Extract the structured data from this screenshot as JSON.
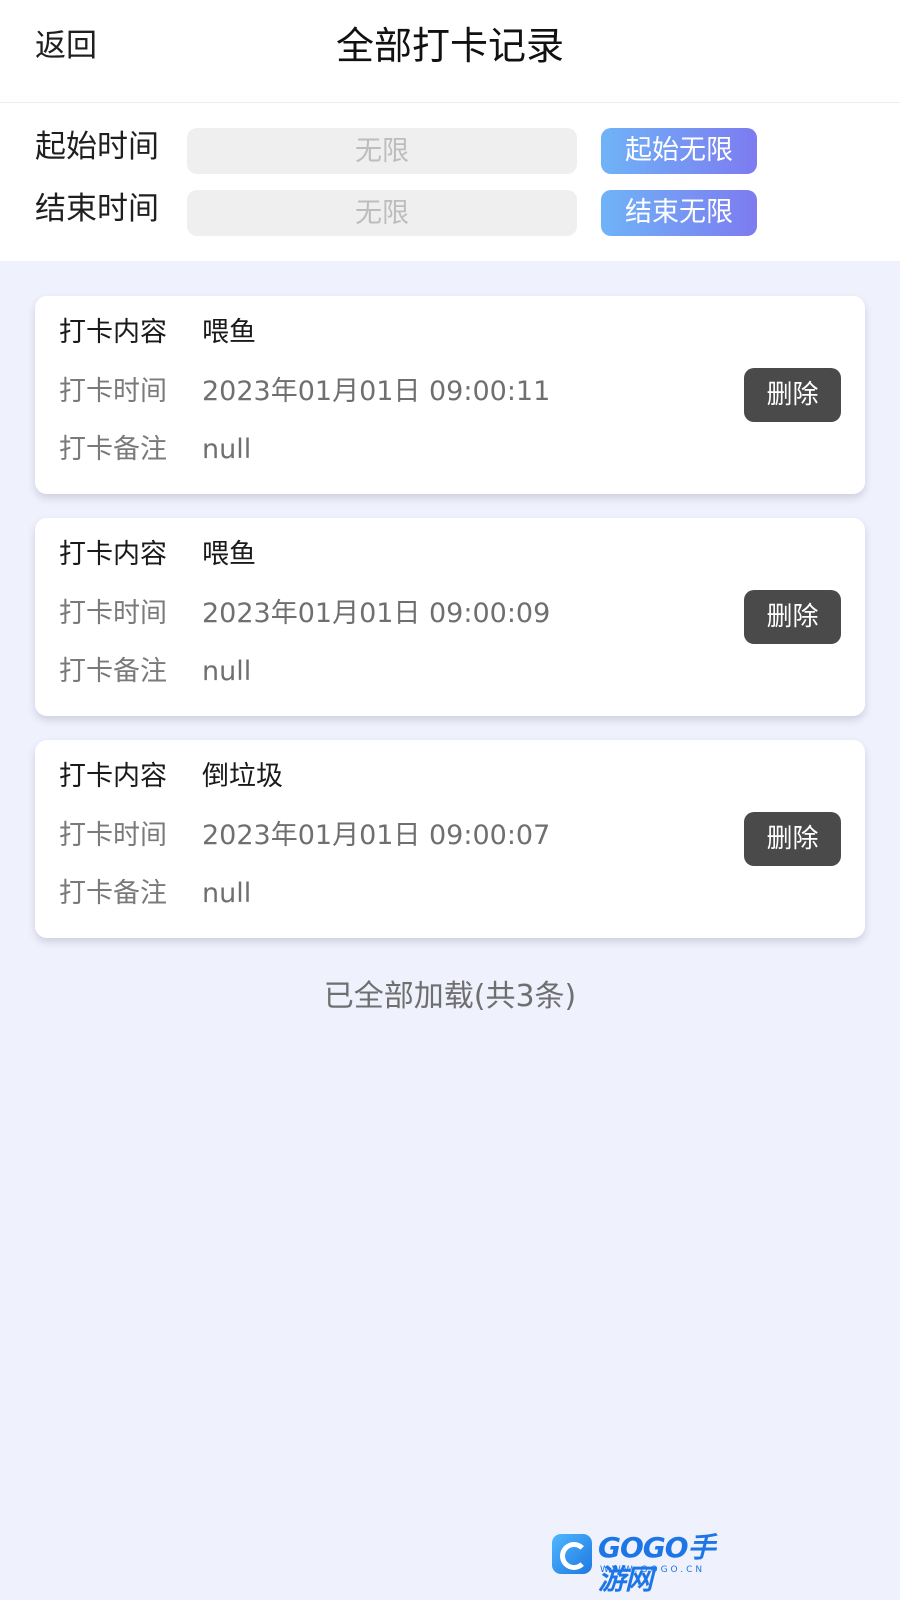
{
  "header": {
    "back_label": "返回",
    "title": "全部打卡记录"
  },
  "filter": {
    "start": {
      "label": "起始时间",
      "placeholder": "无限",
      "button": "起始无限"
    },
    "end": {
      "label": "结束时间",
      "placeholder": "无限",
      "button": "结束无限"
    }
  },
  "field_labels": {
    "content": "打卡内容",
    "time": "打卡时间",
    "note": "打卡备注"
  },
  "records": [
    {
      "content": "喂鱼",
      "time": "2023年01月01日 09:00:11",
      "note": "null",
      "delete_label": "删除"
    },
    {
      "content": "喂鱼",
      "time": "2023年01月01日 09:00:09",
      "note": "null",
      "delete_label": "删除"
    },
    {
      "content": "倒垃圾",
      "time": "2023年01月01日 09:00:07",
      "note": "null",
      "delete_label": "删除"
    }
  ],
  "status": {
    "load_text": "已全部加载(共3条)"
  },
  "watermark": {
    "brand": "GOGO手游网",
    "url": "WWW.GOGO.CN"
  },
  "colors": {
    "background": "#eff1fd",
    "accent_gradient_start": "#6fb3f7",
    "accent_gradient_end": "#7d7bf0",
    "delete_button": "#4a4a4a"
  }
}
